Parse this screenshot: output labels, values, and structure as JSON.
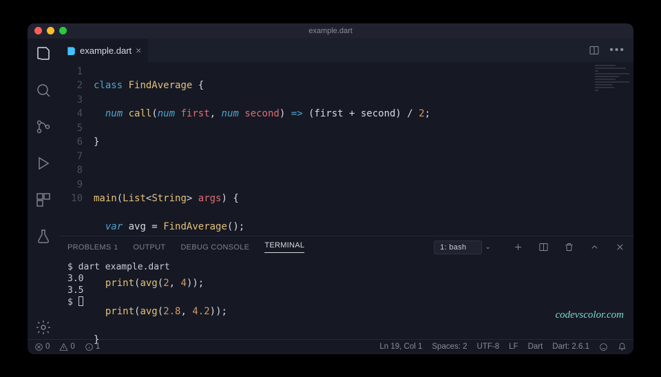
{
  "title": "example.dart",
  "tab": {
    "label": "example.dart"
  },
  "code": {
    "lines": [
      1,
      2,
      3,
      4,
      5,
      6,
      7,
      8,
      9,
      10
    ],
    "l1_class": "class",
    "l1_name": "FindAverage",
    "l1_brace": "{",
    "l2_type1": "num",
    "l2_call": "call",
    "l2_p": "(",
    "l2_type2": "num",
    "l2_first": "first",
    "l2_comma": ",",
    "l2_type3": "num",
    "l2_second": "second",
    "l2_cp": ")",
    "l2_arrow": "=>",
    "l2_op": "(first + second) /",
    "l2_two": "2",
    "l2_semi": ";",
    "l3_brace": "}",
    "l5_main": "main",
    "l5_p": "(",
    "l5_list": "List",
    "l5_lt": "<",
    "l5_string": "String",
    "l5_gt": ">",
    "l5_args": "args",
    "l5_cp": ") {",
    "l6_var": "var",
    "l6_avg": "avg =",
    "l6_FA": "FindAverage",
    "l6_end": "();",
    "l8_print": "print",
    "l8_p": "(",
    "l8_avg": "avg",
    "l8_p2": "(",
    "l8_n1": "2",
    "l8_c": ",",
    "l8_n2": "4",
    "l8_end": "));",
    "l9_print": "print",
    "l9_p": "(",
    "l9_avg": "avg",
    "l9_p2": "(",
    "l9_n1": "2.8",
    "l9_c": ",",
    "l9_n2": "4.2",
    "l9_end": "));",
    "l10_brace": "}"
  },
  "panel": {
    "tabs": {
      "problems": "PROBLEMS",
      "problems_count": "1",
      "output": "OUTPUT",
      "debug": "DEBUG CONSOLE",
      "terminal": "TERMINAL"
    },
    "select": "1: bash"
  },
  "terminal": {
    "line1": "$ dart example.dart",
    "line2": "3.0",
    "line3": "3.5",
    "prompt": "$ "
  },
  "watermark": "codevscolor.com",
  "status": {
    "errors": "0",
    "warnings": "0",
    "info": "1",
    "position": "Ln 19, Col 1",
    "spaces": "Spaces: 2",
    "encoding": "UTF-8",
    "eol": "LF",
    "lang": "Dart",
    "sdk": "Dart: 2.6.1"
  }
}
